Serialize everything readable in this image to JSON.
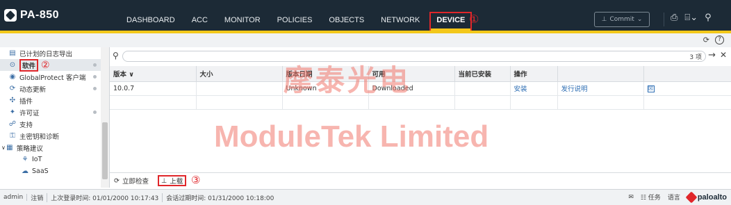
{
  "app": {
    "name": "PA-850"
  },
  "nav": {
    "tabs": [
      {
        "label": "DASHBOARD"
      },
      {
        "label": "ACC"
      },
      {
        "label": "MONITOR"
      },
      {
        "label": "POLICIES"
      },
      {
        "label": "OBJECTS"
      },
      {
        "label": "NETWORK"
      },
      {
        "label": "DEVICE",
        "active": true
      }
    ],
    "annotation": "①",
    "commit_label": "Commit"
  },
  "sidebar": {
    "items": [
      {
        "label": "已计划的日志导出",
        "icon": "export-icon",
        "dot": false,
        "indent": 1
      },
      {
        "label": "软件",
        "icon": "software-icon",
        "dot": true,
        "indent": 1,
        "selected": true
      },
      {
        "label": "GlobalProtect 客户端",
        "icon": "globe-icon",
        "dot": true,
        "indent": 1
      },
      {
        "label": "动态更新",
        "icon": "update-icon",
        "dot": true,
        "indent": 1
      },
      {
        "label": "插件",
        "icon": "plugin-icon",
        "dot": false,
        "indent": 1
      },
      {
        "label": "许可证",
        "icon": "license-icon",
        "dot": true,
        "indent": 1
      },
      {
        "label": "支持",
        "icon": "support-icon",
        "dot": false,
        "indent": 1
      },
      {
        "label": "主密钥和诊断",
        "icon": "key-icon",
        "dot": false,
        "indent": 1
      },
      {
        "label": "策略建议",
        "icon": "policy-icon",
        "dot": false,
        "indent": 0,
        "expanded": true
      },
      {
        "label": "IoT",
        "icon": "iot-icon",
        "dot": false,
        "indent": 2
      },
      {
        "label": "SaaS",
        "icon": "saas-icon",
        "dot": false,
        "indent": 2
      }
    ],
    "annotation": "②"
  },
  "search": {
    "count": "3 项"
  },
  "table": {
    "columns": [
      "版本 ∨",
      "大小",
      "版本日期",
      "可用",
      "当前已安装",
      "操作",
      "",
      ""
    ],
    "rows": [
      {
        "version": "10.0.7",
        "size": "",
        "date": "Unknown",
        "available": "Downloaded",
        "installed": "",
        "action": "安装",
        "notes": "发行说明",
        "delete": "☒"
      }
    ]
  },
  "actions": {
    "check_now": "立即检查",
    "upload": "上载",
    "annotation": "③"
  },
  "status": {
    "user": "admin",
    "logout": "注销",
    "last_login": "上次登录时间: 01/01/2000 10:17:43",
    "session_expire": "会话过期时间: 01/31/2000 10:18:00",
    "tasks": "任务",
    "language": "语言",
    "vendor": "paloalto"
  },
  "watermark": {
    "cn": "摩泰光电",
    "en": "ModuleTek Limited"
  }
}
